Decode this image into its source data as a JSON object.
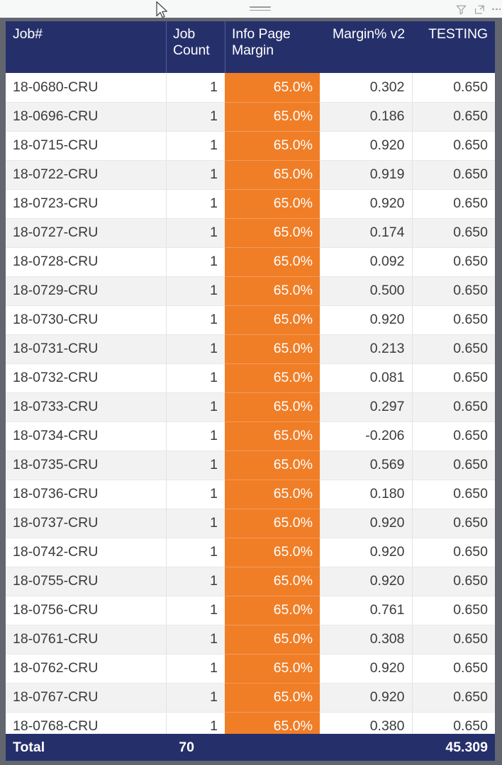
{
  "toolbar": {
    "drag_handle": "drag-handle",
    "icons": [
      {
        "name": "filter-icon",
        "label": "Filters"
      },
      {
        "name": "focus-mode-icon",
        "label": "Focus mode"
      },
      {
        "name": "more-options-icon",
        "label": "More options"
      }
    ]
  },
  "colors": {
    "header_navy": "#25306b",
    "conditional_orange": "#f07e27",
    "row_alt": "#f2f2f2",
    "frame_gray": "#62666e",
    "text": "#3b3b3b"
  },
  "table": {
    "columns": [
      {
        "key": "job",
        "label": "Job#",
        "align": "left"
      },
      {
        "key": "count",
        "label": "Job Count",
        "align": "right"
      },
      {
        "key": "margin",
        "label": "Info Page Margin",
        "align": "right"
      },
      {
        "key": "m2",
        "label": "Margin% v2",
        "align": "right"
      },
      {
        "key": "test",
        "label": "TESTING",
        "align": "right"
      }
    ],
    "rows": [
      {
        "job": "18-0680-CRU",
        "count": "1",
        "margin": "65.0%",
        "m2": "0.302",
        "test": "0.650"
      },
      {
        "job": "18-0696-CRU",
        "count": "1",
        "margin": "65.0%",
        "m2": "0.186",
        "test": "0.650"
      },
      {
        "job": "18-0715-CRU",
        "count": "1",
        "margin": "65.0%",
        "m2": "0.920",
        "test": "0.650"
      },
      {
        "job": "18-0722-CRU",
        "count": "1",
        "margin": "65.0%",
        "m2": "0.919",
        "test": "0.650"
      },
      {
        "job": "18-0723-CRU",
        "count": "1",
        "margin": "65.0%",
        "m2": "0.920",
        "test": "0.650"
      },
      {
        "job": "18-0727-CRU",
        "count": "1",
        "margin": "65.0%",
        "m2": "0.174",
        "test": "0.650"
      },
      {
        "job": "18-0728-CRU",
        "count": "1",
        "margin": "65.0%",
        "m2": "0.092",
        "test": "0.650"
      },
      {
        "job": "18-0729-CRU",
        "count": "1",
        "margin": "65.0%",
        "m2": "0.500",
        "test": "0.650"
      },
      {
        "job": "18-0730-CRU",
        "count": "1",
        "margin": "65.0%",
        "m2": "0.920",
        "test": "0.650"
      },
      {
        "job": "18-0731-CRU",
        "count": "1",
        "margin": "65.0%",
        "m2": "0.213",
        "test": "0.650"
      },
      {
        "job": "18-0732-CRU",
        "count": "1",
        "margin": "65.0%",
        "m2": "0.081",
        "test": "0.650"
      },
      {
        "job": "18-0733-CRU",
        "count": "1",
        "margin": "65.0%",
        "m2": "0.297",
        "test": "0.650"
      },
      {
        "job": "18-0734-CRU",
        "count": "1",
        "margin": "65.0%",
        "m2": "-0.206",
        "test": "0.650"
      },
      {
        "job": "18-0735-CRU",
        "count": "1",
        "margin": "65.0%",
        "m2": "0.569",
        "test": "0.650"
      },
      {
        "job": "18-0736-CRU",
        "count": "1",
        "margin": "65.0%",
        "m2": "0.180",
        "test": "0.650"
      },
      {
        "job": "18-0737-CRU",
        "count": "1",
        "margin": "65.0%",
        "m2": "0.920",
        "test": "0.650"
      },
      {
        "job": "18-0742-CRU",
        "count": "1",
        "margin": "65.0%",
        "m2": "0.920",
        "test": "0.650"
      },
      {
        "job": "18-0755-CRU",
        "count": "1",
        "margin": "65.0%",
        "m2": "0.920",
        "test": "0.650"
      },
      {
        "job": "18-0756-CRU",
        "count": "1",
        "margin": "65.0%",
        "m2": "0.761",
        "test": "0.650"
      },
      {
        "job": "18-0761-CRU",
        "count": "1",
        "margin": "65.0%",
        "m2": "0.308",
        "test": "0.650"
      },
      {
        "job": "18-0762-CRU",
        "count": "1",
        "margin": "65.0%",
        "m2": "0.920",
        "test": "0.650"
      },
      {
        "job": "18-0767-CRU",
        "count": "1",
        "margin": "65.0%",
        "m2": "0.920",
        "test": "0.650"
      },
      {
        "job": "18-0768-CRU",
        "count": "1",
        "margin": "65.0%",
        "m2": "0.380",
        "test": "0.650"
      }
    ],
    "total": {
      "job": "Total",
      "count": "70",
      "margin": "",
      "m2": "",
      "test": "45.309"
    }
  }
}
